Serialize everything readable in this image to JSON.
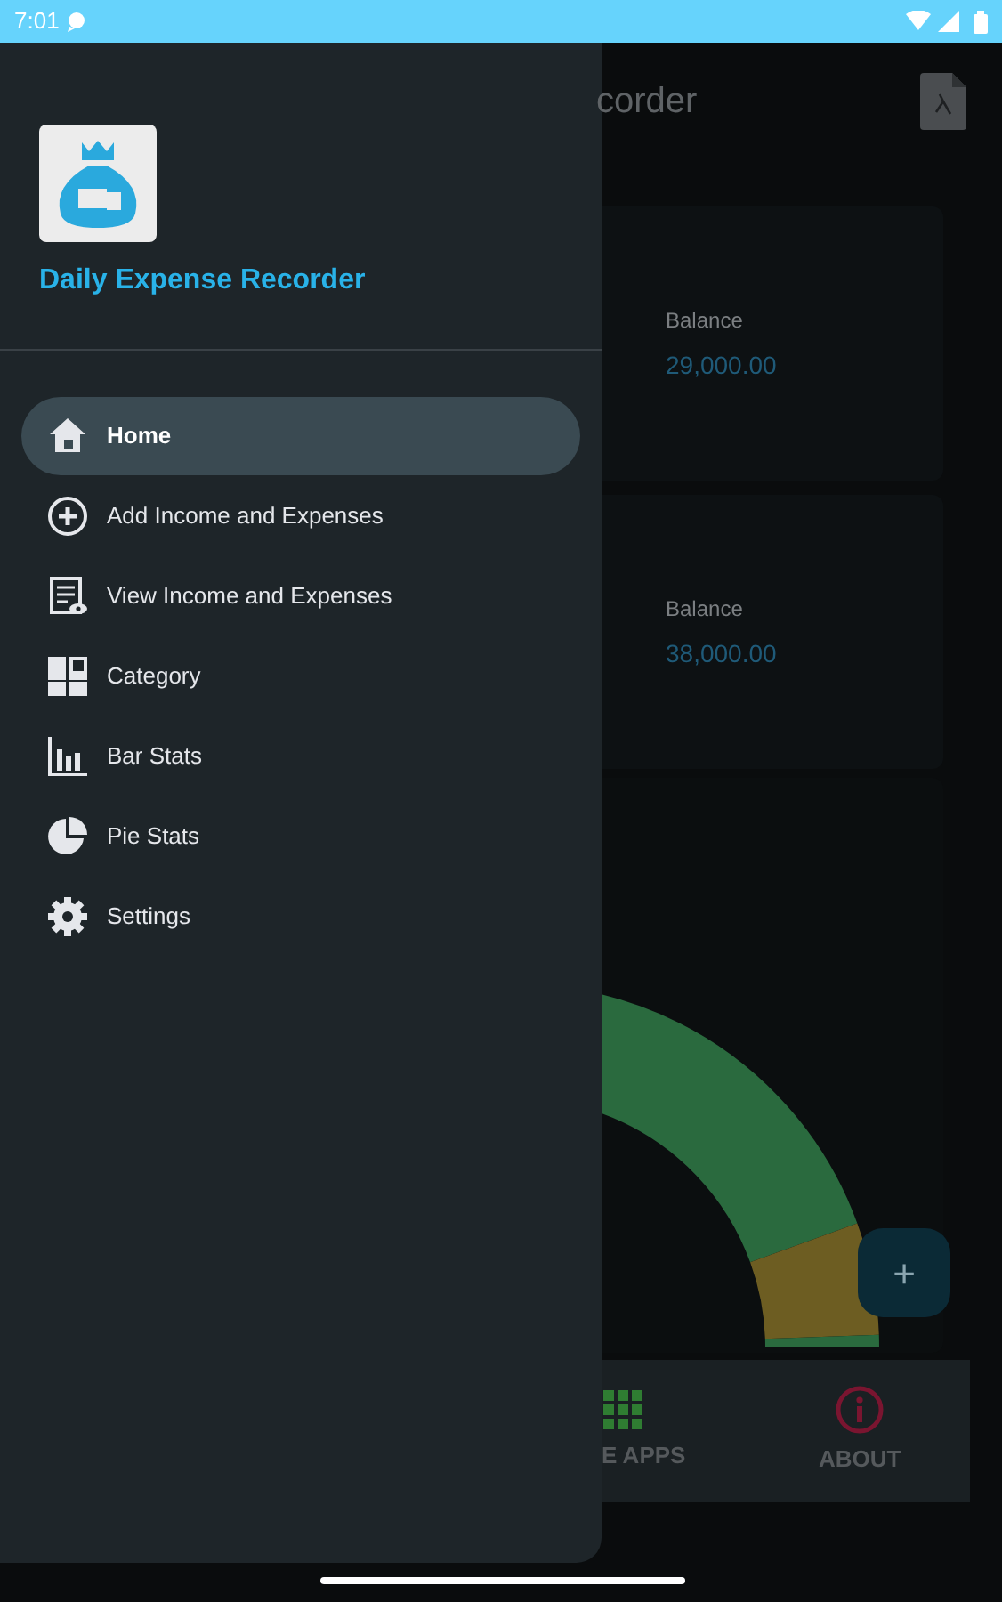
{
  "status_bar": {
    "time": "7:01"
  },
  "drawer": {
    "app_name": "Daily Expense Recorder",
    "items": [
      {
        "kind": "home",
        "label": "Home",
        "selected": true
      },
      {
        "kind": "add",
        "label": "Add Income and Expenses",
        "selected": false
      },
      {
        "kind": "view",
        "label": "View Income and Expenses",
        "selected": false
      },
      {
        "kind": "category",
        "label": "Category",
        "selected": false
      },
      {
        "kind": "bar",
        "label": "Bar Stats",
        "selected": false
      },
      {
        "kind": "pie",
        "label": "Pie Stats",
        "selected": false
      },
      {
        "kind": "settings",
        "label": "Settings",
        "selected": false
      }
    ]
  },
  "background": {
    "title": "corder",
    "cards": [
      {
        "label": "Balance",
        "value": "29,000.00"
      },
      {
        "label": "Balance",
        "value": "38,000.00"
      }
    ],
    "fab": {
      "label": "+"
    },
    "bottom_nav": [
      {
        "kind": "apps",
        "label": "E APPS"
      },
      {
        "kind": "about",
        "label": "ABOUT"
      }
    ]
  }
}
